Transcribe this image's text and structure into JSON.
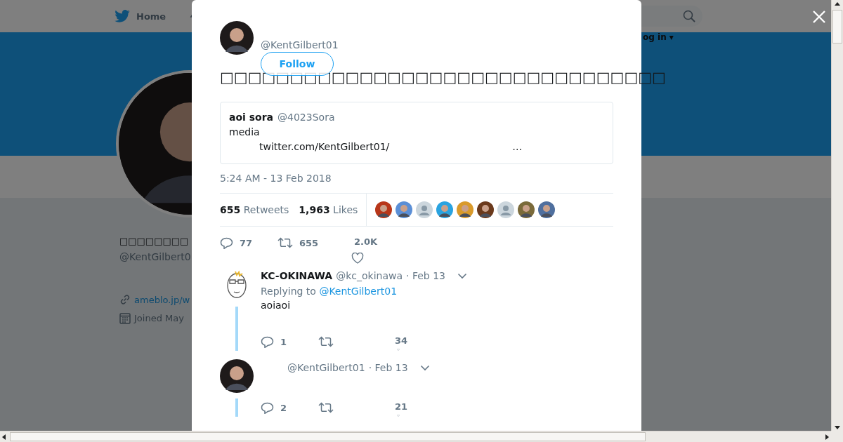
{
  "header": {
    "home": "Home",
    "login": "og in ▾"
  },
  "profile": {
    "name": "□□□□□□□□",
    "handle": "@KentGilbert0",
    "link": "ameblo.jp/w",
    "joined": "Joined May"
  },
  "tweet": {
    "handle": "@KentGilbert01",
    "follow": "Follow",
    "text": "□□□□□□□□□□□□□□□□□□□□□□□□□□□□□□□□",
    "quote": {
      "name": "aoi sora",
      "handle": "@4023Sora",
      "text": "media",
      "url": "twitter.com/KentGilbert01/",
      "ellipsis": "…"
    },
    "timestamp": "5:24 AM - 13 Feb 2018",
    "stats": [
      {
        "count": "655",
        "label": "Retweets"
      },
      {
        "count": "1,963",
        "label": "Likes"
      }
    ],
    "likers": [
      {
        "kind": "photo",
        "color": "#b8371a"
      },
      {
        "kind": "photo",
        "color": "#5b8fd6"
      },
      {
        "kind": "default"
      },
      {
        "kind": "photo",
        "color": "#2aa3e0"
      },
      {
        "kind": "photo",
        "color": "#d99a2b"
      },
      {
        "kind": "photo",
        "color": "#6b3a1c"
      },
      {
        "kind": "default"
      },
      {
        "kind": "photo",
        "color": "#7a6a3a"
      },
      {
        "kind": "photo",
        "color": "#4f6f9e"
      }
    ],
    "actions": {
      "replies": "77",
      "retweets": "655",
      "likes": "2.0K"
    }
  },
  "replies": [
    {
      "kind": "sketch",
      "name": "KC-OKINAWA",
      "handle": "@kc_okinawa",
      "date": "· Feb 13",
      "replying": "Replying to",
      "mention": "@KentGilbert01",
      "text": "aoiaoi",
      "replies": "1",
      "likes": "34"
    },
    {
      "kind": "photo",
      "handle": "@KentGilbert01",
      "date": "· Feb 13",
      "replies": "2",
      "likes": "21"
    }
  ]
}
